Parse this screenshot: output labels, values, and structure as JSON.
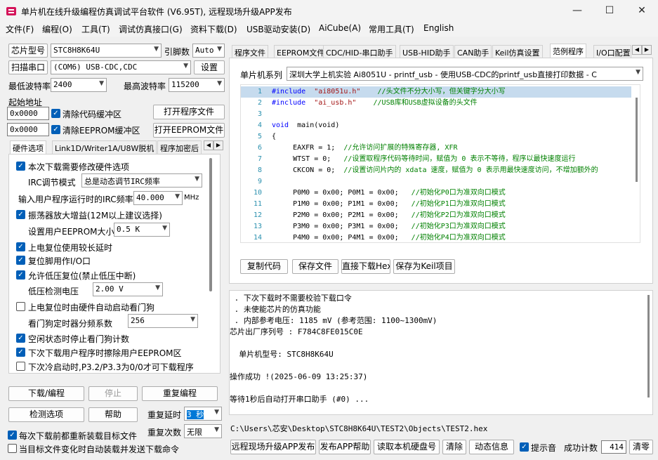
{
  "window": {
    "title": "单片机在线升级编程仿真调试平台软件 (V6.95T), 远程现场升级APP发布",
    "min_glyph": "—",
    "max_glyph": "☐",
    "close_glyph": "✕"
  },
  "menu": [
    "文件(F)",
    "编程(O)",
    "工具(T)",
    "调试仿真接口(G)",
    "资料下载(D)",
    "USB驱动安装(D)",
    "AiCube(A)",
    "常用工具(T)",
    "English"
  ],
  "left": {
    "chip_model_label": "芯片型号",
    "chip_model_value": "STC8H8K64U",
    "pin_count_label": "引脚数",
    "pin_count_value": "Auto",
    "scan_port_button": "扫描串口",
    "port_value": "(COM6) USB-CDC,CDC",
    "settings_button": "设置",
    "min_baud_label": "最低波特率",
    "min_baud_value": "2400",
    "max_baud_label": "最高波特率",
    "max_baud_value": "115200",
    "start_addr_label": "起始地址",
    "code_addr_value": "0x0000",
    "clear_code_label": "清除代码缓冲区",
    "open_program_button": "打开程序文件",
    "eeprom_addr_value": "0x0000",
    "clear_eeprom_label": "清除EEPROM缓冲区",
    "open_eeprom_button": "打开EEPROM文件",
    "tabs": [
      "硬件选项",
      "Link1D/Writer1A/U8W脱机",
      "程序加密后"
    ],
    "tab_prev": "◀",
    "tab_next": "▶",
    "options": {
      "opt1": "本次下载需要修改硬件选项",
      "irc_mode_label": "IRC调节模式",
      "irc_mode_value": "总是动态调节IRC频率",
      "irc_freq_label": "输入用户程序运行时的IRC频率",
      "irc_freq_value": "40.000",
      "irc_freq_unit": "MHz",
      "opt2": "振荡器放大增益(12M以上建议选择)",
      "eeprom_size_label": "设置用户EEPROM大小",
      "eeprom_size_value": "0.5 K",
      "opt3": "上电复位使用较长延时",
      "opt4": "复位脚用作I/O口",
      "opt5": "允许低压复位(禁止低压中断)",
      "lvd_label": "低压检测电压",
      "lvd_value": "2.00 V",
      "opt6": "上电复位时由硬件自动启动看门狗",
      "wdt_label": "看门狗定时器分频系数",
      "wdt_value": "256",
      "opt7": "空闲状态时停止看门狗计数",
      "opt8": "下次下载用户程序时擦除用户EEPROM区",
      "opt9": "下次冷启动时,P3.2/P3.3为0/0才可下载程序"
    },
    "download_button": "下载/编程",
    "stop_button": "停止",
    "reprogram_button": "重复编程",
    "detect_button": "检测选项",
    "help_button": "帮助",
    "repeat_delay_label": "重复延时",
    "repeat_delay_value": "3 秒",
    "repeat_count_label": "重复次数",
    "repeat_count_value": "无限",
    "reload_label": "每次下载前都重新装载目标文件",
    "auto_load_label": "当目标文件变化时自动装载并发送下载命令"
  },
  "right": {
    "tabs": [
      "程序文件",
      "EEPROM文件",
      "CDC/HID-串口助手",
      "USB-HID助手",
      "CAN助手",
      "Keil仿真设置",
      "范例程序",
      "I/O口配置"
    ],
    "tab_prev": "◀",
    "tab_next": "▶",
    "series_label": "单片机系列",
    "series_value": "深圳大学上机实验 Ai8051U - printf_usb - 使用USB-CDC的printf_usb直接打印数据 - C",
    "code": [
      {
        "n": "1",
        "a": "#include",
        "b": "  \"ai8051u.h\"",
        "c": "    //头文件不分大小写，但关键字分大小写"
      },
      {
        "n": "2",
        "a": "#include",
        "b": "  \"ai_usb.h\"",
        "c": "    //USB库和USB虚拟设备的头文件"
      },
      {
        "n": "3",
        "a": "",
        "b": "",
        "c": ""
      },
      {
        "n": "4",
        "a": "void",
        "b": "  main(void)",
        "c": ""
      },
      {
        "n": "5",
        "a": "",
        "b": "{",
        "c": ""
      },
      {
        "n": "6",
        "a": "",
        "b": "     EAXFR = 1;",
        "c": "  //允许访问扩展的特殊寄存器, XFR"
      },
      {
        "n": "7",
        "a": "",
        "b": "     WTST = 0;",
        "c": "   //设置取程序代码等待时间，赋值为 0 表示不等待，程序以最快速度运行"
      },
      {
        "n": "8",
        "a": "",
        "b": "     CKCON = 0;",
        "c": "  //设置访问片内的 xdata 速度，赋值为 0 表示用最快速度访问，不增加额外的"
      },
      {
        "n": "9",
        "a": "",
        "b": "",
        "c": ""
      },
      {
        "n": "10",
        "a": "",
        "b": "     P0M0 = 0x00; P0M1 = 0x00;",
        "c": "   //初始化P0口为准双向口模式"
      },
      {
        "n": "11",
        "a": "",
        "b": "     P1M0 = 0x00; P1M1 = 0x00;",
        "c": "   //初始化P1口为准双向口模式"
      },
      {
        "n": "12",
        "a": "",
        "b": "     P2M0 = 0x00; P2M1 = 0x00;",
        "c": "   //初始化P2口为准双向口模式"
      },
      {
        "n": "13",
        "a": "",
        "b": "     P3M0 = 0x00; P3M1 = 0x00;",
        "c": "   //初始化P3口为准双向口模式"
      },
      {
        "n": "14",
        "a": "",
        "b": "     P4M0 = 0x00; P4M1 = 0x00;",
        "c": "   //初始化P4口为准双向口模式"
      }
    ],
    "copy_code_button": "复制代码",
    "save_file_button": "保存文件",
    "direct_download_button": "直接下载Hex",
    "save_keil_button": "保存为Keil项目",
    "log": [
      " . 下次下载时不需要校验下载口令",
      " . 未使能芯片的仿真功能",
      " . 内部参考电压: 1185 mV (参考范围: 1100~1300mV)",
      "芯片出厂序列号 : F784C8FE015C0E",
      "",
      "  单片机型号: STC8H8K64U",
      "",
      "操作成功 !(2025-06-09 13:25:37)",
      "",
      "等待1秒后自动打开串口助手 (#0) ..."
    ],
    "file_path": "C:\\Users\\芯安\\Desktop\\STC8H8K64U\\TEST2\\Objects\\TEST2.hex",
    "remote_upgrade_button": "远程现场升级APP发布",
    "publish_help_button": "发布APP帮助",
    "read_disk_button": "读取本机硬盘号",
    "clear_button": "清除",
    "anim_button": "动态信息",
    "beep_label": "提示音",
    "success_label": "成功计数",
    "success_count": "414",
    "reset_button": "清零"
  }
}
